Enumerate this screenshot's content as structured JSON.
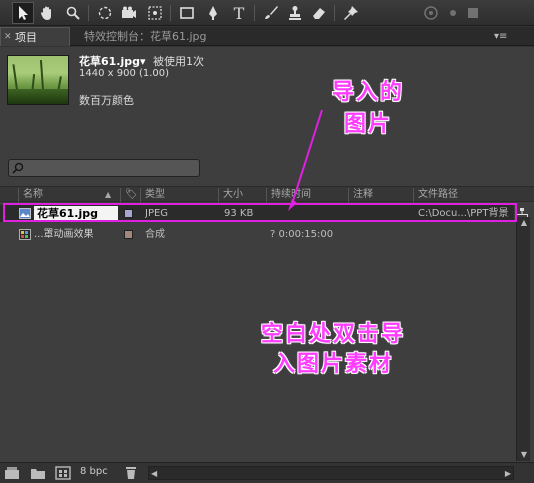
{
  "toolbar": {
    "tools": [
      "selection-tool",
      "hand-tool",
      "zoom-tool",
      "rotation-tool",
      "camera-tool",
      "pan-behind-tool",
      "rectangle-tool",
      "pen-tool",
      "type-tool",
      "brush-tool",
      "clone-stamp-tool",
      "eraser-tool",
      "puppet-pin-tool"
    ],
    "type_tool_glyph": "T"
  },
  "tabs": {
    "project_label": "项目",
    "effect_controls_label": "特效控制台：花草61.jpg"
  },
  "preview": {
    "file_name": "花草61.jpg▾",
    "usage": "被使用1次",
    "dimensions": "1440 x 900 (1.00)",
    "color_depth": "数百万颜色"
  },
  "columns": {
    "name": "名称",
    "type": "类型",
    "size": "大小",
    "duration": "持续时间",
    "comment": "注释",
    "file_path": "文件路径"
  },
  "items": [
    {
      "name": "花草61.jpg",
      "type": "JPEG",
      "size": "93 KB",
      "duration": "",
      "comment": "",
      "path": "C:\\Docu...\\PPT背景",
      "label_color": "#a6a6d0"
    },
    {
      "name": "...罩动画效果",
      "type": "合成",
      "size": "",
      "duration": "? 0:00:15:00",
      "comment": "",
      "path": "",
      "label_color": "#a0897a"
    }
  ],
  "bottom": {
    "bit_depth": "8 bpc"
  },
  "annotations": {
    "imported_image": [
      "导入的",
      "图片"
    ],
    "double_click_hint": [
      "空白处双击导",
      "入图片素材"
    ],
    "accent_color": "#ff3cff"
  }
}
